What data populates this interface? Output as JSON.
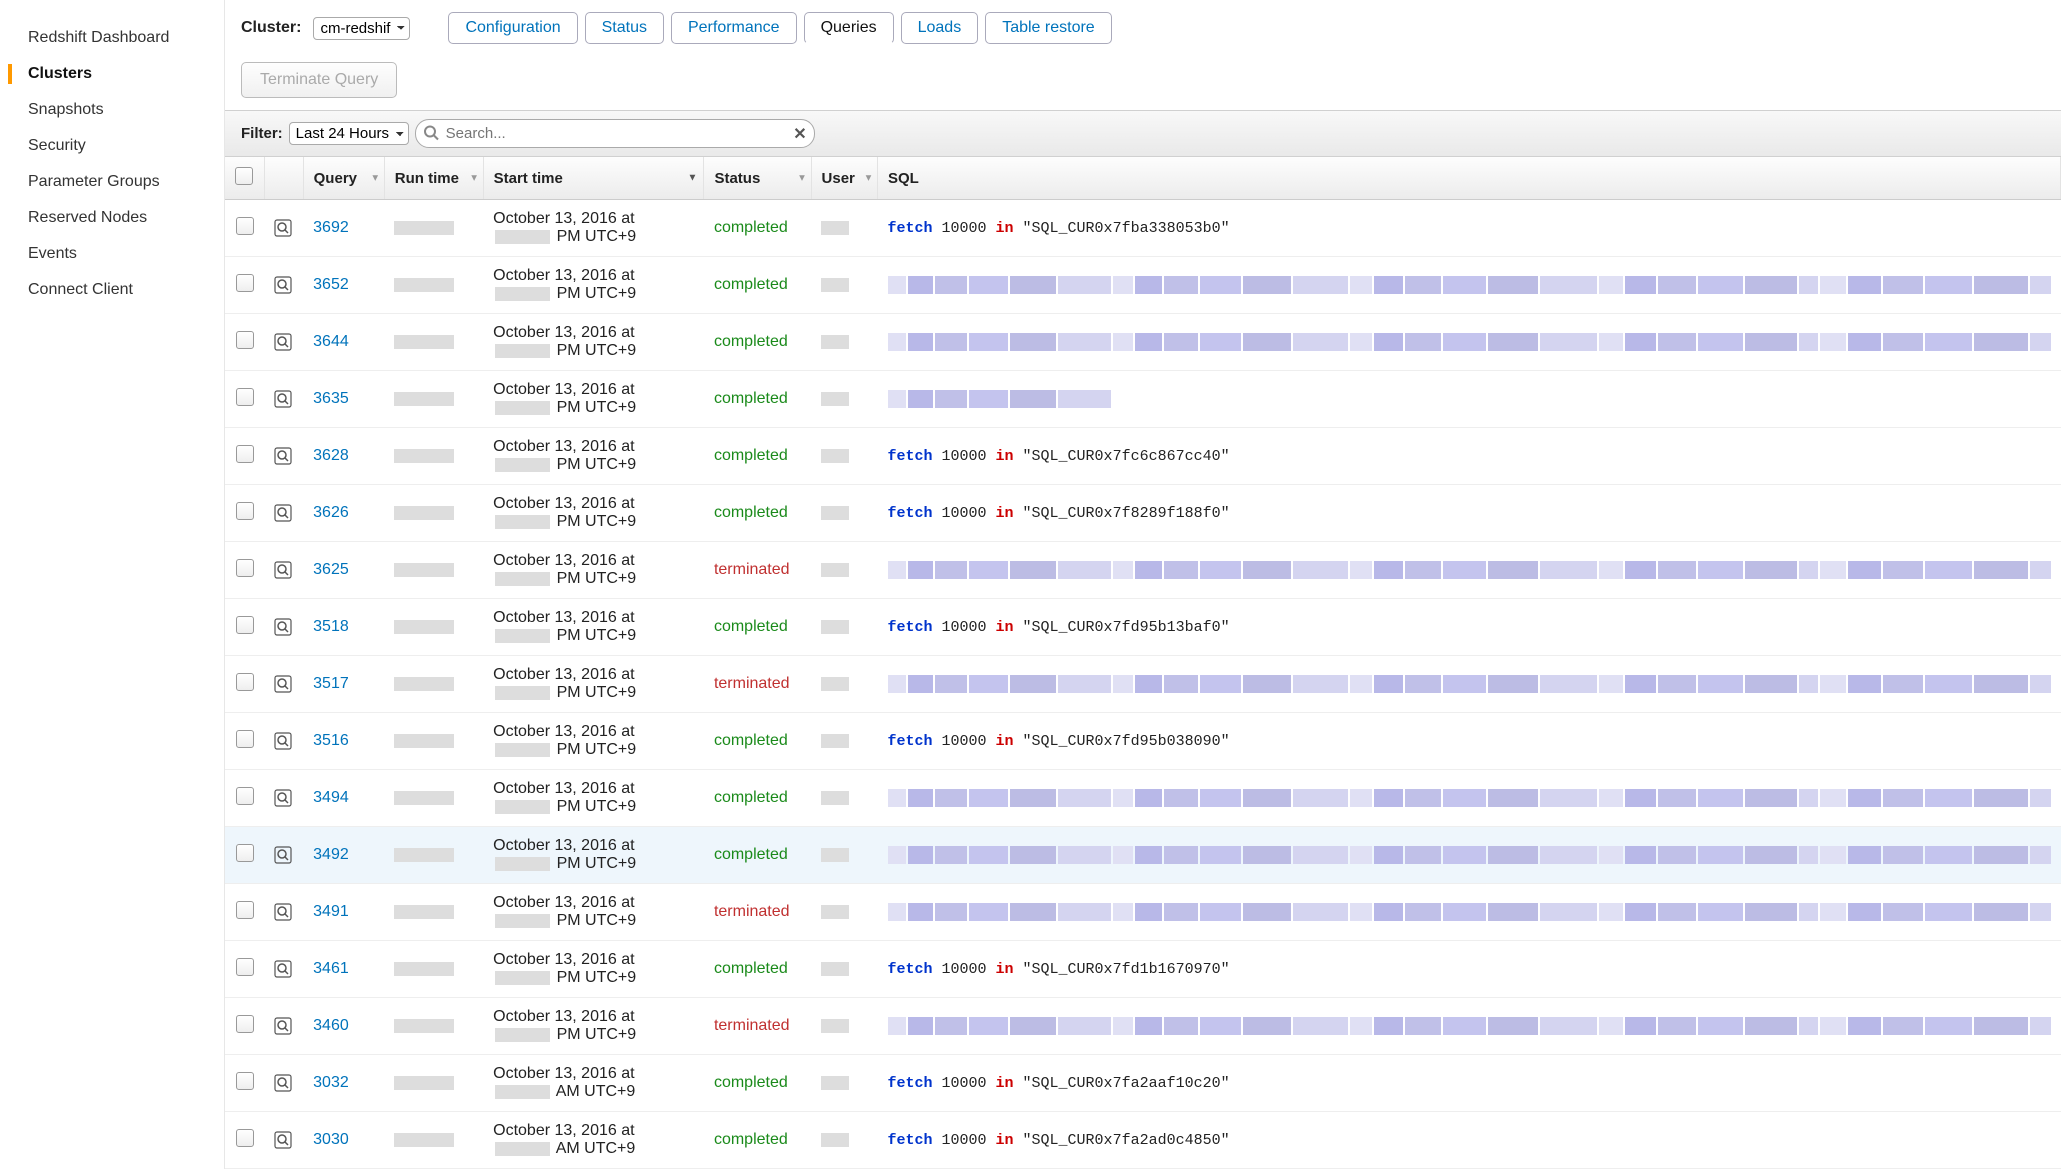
{
  "sidebar": {
    "items": [
      {
        "label": "Redshift Dashboard",
        "active": false
      },
      {
        "label": "Clusters",
        "active": true
      },
      {
        "label": "Snapshots",
        "active": false
      },
      {
        "label": "Security",
        "active": false
      },
      {
        "label": "Parameter Groups",
        "active": false
      },
      {
        "label": "Reserved Nodes",
        "active": false
      },
      {
        "label": "Events",
        "active": false
      },
      {
        "label": "Connect Client",
        "active": false
      }
    ]
  },
  "header": {
    "cluster_label": "Cluster:",
    "cluster_value": "cm-redshif",
    "tabs": [
      {
        "label": "Configuration",
        "active": false
      },
      {
        "label": "Status",
        "active": false
      },
      {
        "label": "Performance",
        "active": false
      },
      {
        "label": "Queries",
        "active": true
      },
      {
        "label": "Loads",
        "active": false
      },
      {
        "label": "Table restore",
        "active": false
      }
    ]
  },
  "toolbar": {
    "terminate_label": "Terminate Query"
  },
  "filter": {
    "label": "Filter:",
    "range_value": "Last 24 Hours",
    "search_placeholder": "Search..."
  },
  "columns": {
    "query": "Query",
    "runtime": "Run time",
    "start": "Start time",
    "status": "Status",
    "user": "User",
    "sql": "SQL"
  },
  "rows": [
    {
      "id": "3692",
      "start_pre": "October 13, 2016 at ",
      "start_post": "PM UTC+9",
      "status": "completed",
      "sql_type": "fetch",
      "sql_count": "10000",
      "sql_cursor": "\"SQL_CUR0x7fba338053b0\""
    },
    {
      "id": "3652",
      "start_pre": "October 13, 2016 at ",
      "start_post": "PM UTC+9",
      "status": "completed",
      "sql_type": "mosaic"
    },
    {
      "id": "3644",
      "start_pre": "October 13, 2016 at ",
      "start_post": "PM UTC+9",
      "status": "completed",
      "sql_type": "mosaic"
    },
    {
      "id": "3635",
      "start_pre": "October 13, 2016 at ",
      "start_post": "PM UTC+9",
      "status": "completed",
      "sql_type": "mosaic-short"
    },
    {
      "id": "3628",
      "start_pre": "October 13, 2016 at ",
      "start_post": "PM UTC+9",
      "status": "completed",
      "sql_type": "fetch",
      "sql_count": "10000",
      "sql_cursor": "\"SQL_CUR0x7fc6c867cc40\""
    },
    {
      "id": "3626",
      "start_pre": "October 13, 2016 at ",
      "start_post": "PM UTC+9",
      "status": "completed",
      "sql_type": "fetch",
      "sql_count": "10000",
      "sql_cursor": "\"SQL_CUR0x7f8289f188f0\""
    },
    {
      "id": "3625",
      "start_pre": "October 13, 2016 at ",
      "start_post": "PM UTC+9",
      "status": "terminated",
      "sql_type": "mosaic"
    },
    {
      "id": "3518",
      "start_pre": "October 13, 2016 at ",
      "start_post": "PM UTC+9",
      "status": "completed",
      "sql_type": "fetch",
      "sql_count": "10000",
      "sql_cursor": "\"SQL_CUR0x7fd95b13baf0\""
    },
    {
      "id": "3517",
      "start_pre": "October 13, 2016 at ",
      "start_post": "PM UTC+9",
      "status": "terminated",
      "sql_type": "mosaic"
    },
    {
      "id": "3516",
      "start_pre": "October 13, 2016 at ",
      "start_post": "PM UTC+9",
      "status": "completed",
      "sql_type": "fetch",
      "sql_count": "10000",
      "sql_cursor": "\"SQL_CUR0x7fd95b038090\""
    },
    {
      "id": "3494",
      "start_pre": "October 13, 2016 at ",
      "start_post": "PM UTC+9",
      "status": "completed",
      "sql_type": "mosaic"
    },
    {
      "id": "3492",
      "start_pre": "October 13, 2016 at ",
      "start_post": "PM UTC+9",
      "status": "completed",
      "sql_type": "mosaic",
      "hovered": true
    },
    {
      "id": "3491",
      "start_pre": "October 13, 2016 at ",
      "start_post": "PM UTC+9",
      "status": "terminated",
      "sql_type": "mosaic"
    },
    {
      "id": "3461",
      "start_pre": "October 13, 2016 at ",
      "start_post": "PM UTC+9",
      "status": "completed",
      "sql_type": "fetch",
      "sql_count": "10000",
      "sql_cursor": "\"SQL_CUR0x7fd1b1670970\""
    },
    {
      "id": "3460",
      "start_pre": "October 13, 2016 at ",
      "start_post": "PM UTC+9",
      "status": "terminated",
      "sql_type": "mosaic"
    },
    {
      "id": "3032",
      "start_pre": "October 13, 2016 at ",
      "start_post": "AM UTC+9",
      "status": "completed",
      "sql_type": "fetch",
      "sql_count": "10000",
      "sql_cursor": "\"SQL_CUR0x7fa2aaf10c20\""
    },
    {
      "id": "3030",
      "start_pre": "October 13, 2016 at ",
      "start_post": "AM UTC+9",
      "status": "completed",
      "sql_type": "fetch",
      "sql_count": "10000",
      "sql_cursor": "\"SQL_CUR0x7fa2ad0c4850\""
    }
  ],
  "sql_keywords": {
    "fetch": "fetch",
    "in": "in"
  }
}
